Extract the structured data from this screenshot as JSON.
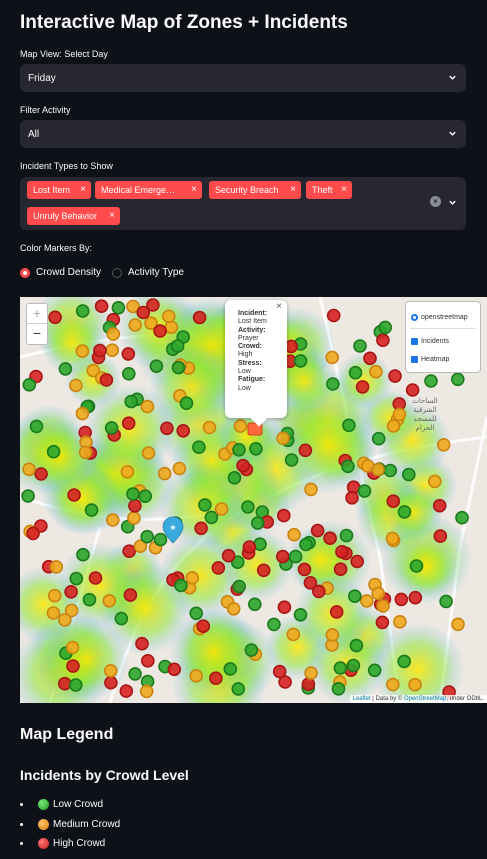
{
  "title": "Interactive Map of Zones + Incidents",
  "map_view": {
    "label": "Map View: Select Day",
    "value": "Friday"
  },
  "filter_activity": {
    "label": "Filter Activity",
    "value": "All"
  },
  "incident_types": {
    "label": "Incident Types to Show",
    "tags": [
      "Lost Item",
      "Medical Emerge…",
      "Security Breach",
      "Theft",
      "Unruly Behavior"
    ],
    "remove_glyph": "×"
  },
  "color_by": {
    "label": "Color Markers By:",
    "options": [
      "Crowd Density",
      "Activity Type"
    ],
    "selected": "Crowd Density"
  },
  "map": {
    "zoom_in": "+",
    "zoom_out": "−",
    "layers": {
      "base": "openstreetmap",
      "overlays": [
        "Incidents",
        "Heatmap"
      ]
    },
    "popup": {
      "close": "×",
      "incident_label": "Incident:",
      "incident_value": "Lost Item",
      "activity_label": "Activity:",
      "activity_value": "Prayer",
      "crowd_label": "Crowd:",
      "crowd_value": "High",
      "stress_label": "Stress:",
      "stress_value": "Low",
      "fatigue_label": "Fatigue:",
      "fatigue_value": "Low"
    },
    "attribution": {
      "leaflet": "Leaflet",
      "mid": " | Data by © ",
      "osm": "OpenStreetMap",
      "tail": ", under ODbL."
    },
    "place_label": [
      "الساحات",
      "الشرقية",
      "للمسجد",
      "الحرام"
    ],
    "colors": {
      "low": "#2ea62e",
      "medium": "#f0a81e",
      "high": "#d62222",
      "accent": "#ff4b4b"
    }
  },
  "legend": {
    "title": "Map Legend",
    "subtitle": "Incidents by Crowd Level",
    "items": [
      "Low Crowd",
      "Medium Crowd",
      "High Crowd"
    ]
  }
}
